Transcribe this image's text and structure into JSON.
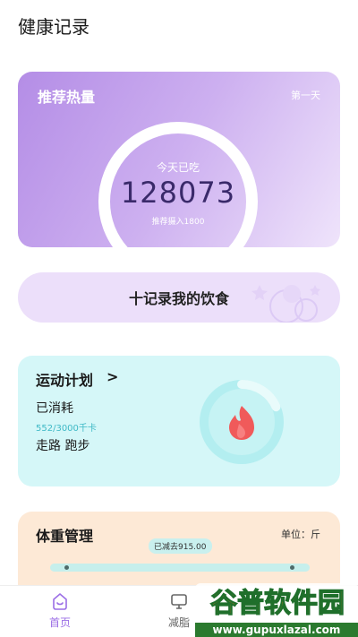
{
  "app": {
    "title": "健康记录"
  },
  "calorie_card": {
    "title": "推荐热量",
    "day": "第一天",
    "eaten_label": "今天已吃",
    "eaten_value": "128073",
    "recommended": "推荐摄入1800"
  },
  "record_button": {
    "label": "十记录我的饮食"
  },
  "sport_card": {
    "title": "运动计划",
    "chevron": ">",
    "burned_label": "已消耗",
    "kcal": "552/3000千卡",
    "activities": "走路 跑步",
    "progress": 0.184,
    "colors": {
      "ring": "#b3eef0",
      "flame": "#f05a5a"
    }
  },
  "weight_card": {
    "title": "体重管理",
    "unit": "单位：斤",
    "lost_badge": "已减去915.00"
  },
  "tabbar": {
    "items": [
      {
        "label": "首页",
        "icon": "home-icon",
        "active": true
      },
      {
        "label": "减脂",
        "icon": "monitor-icon",
        "active": false
      }
    ]
  },
  "watermark": {
    "brand": "谷普软件园",
    "url": "www.gupuxlazal.com"
  },
  "colors": {
    "accent": "#9b6ee6",
    "calorie_gradient_start": "#b48de6",
    "sport_bg": "#d5f7f8",
    "weight_bg": "#fde9d6"
  }
}
